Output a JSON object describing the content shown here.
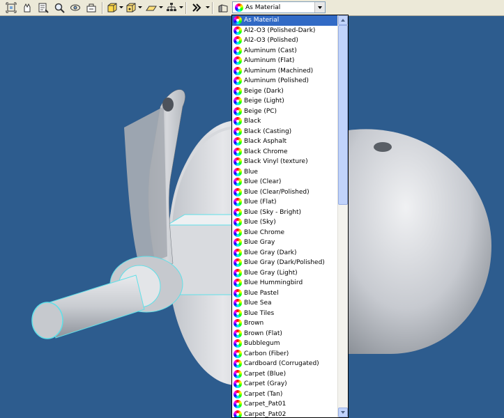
{
  "toolbar": {
    "material_combo": {
      "selected": "As Material",
      "icon": "material-swatch-icon"
    },
    "tools": [
      {
        "name": "zoom-all-icon"
      },
      {
        "name": "pan-icon"
      },
      {
        "name": "zoom-window-icon"
      },
      {
        "name": "zoom-icon"
      },
      {
        "name": "orbit-icon"
      },
      {
        "name": "look-at-icon"
      },
      {
        "name": "shaded-display-icon"
      },
      {
        "name": "perspective-icon"
      },
      {
        "name": "shadow-icon"
      },
      {
        "name": "hierarchy-icon"
      },
      {
        "name": "color-style-icon"
      }
    ]
  },
  "dropdown": {
    "selected_index": 0,
    "items": [
      "As Material",
      "Al2-O3 (Polished-Dark)",
      "Al2-O3 (Polished)",
      "Aluminum (Cast)",
      "Aluminum (Flat)",
      "Aluminum (Machined)",
      "Aluminum (Polished)",
      "Beige (Dark)",
      "Beige (Light)",
      "Beige (PC)",
      "Black",
      "Black (Casting)",
      "Black Asphalt",
      "Black Chrome",
      "Black Vinyl (texture)",
      "Blue",
      "Blue (Clear)",
      "Blue (Clear/Polished)",
      "Blue (Flat)",
      "Blue (Sky - Bright)",
      "Blue (Sky)",
      "Blue Chrome",
      "Blue Gray",
      "Blue Gray (Dark)",
      "Blue Gray (Dark/Polished)",
      "Blue Gray (Light)",
      "Blue Hummingbird",
      "Blue Pastel",
      "Blue Sea",
      "Blue Tiles",
      "Brown",
      "Brown (Flat)",
      "Bubblegum",
      "Carbon (Fiber)",
      "Cardboard (Corrugated)",
      "Carpet (Blue)",
      "Carpet (Gray)",
      "Carpet (Tan)",
      "Carpet_Pat01",
      "Carpet_Pat02"
    ]
  },
  "colors": {
    "viewport_bg": "#2d5c8e",
    "toolbar_bg": "#ece9d8",
    "selection": "#316ac5",
    "edge_highlight": "#5fe0e8"
  }
}
